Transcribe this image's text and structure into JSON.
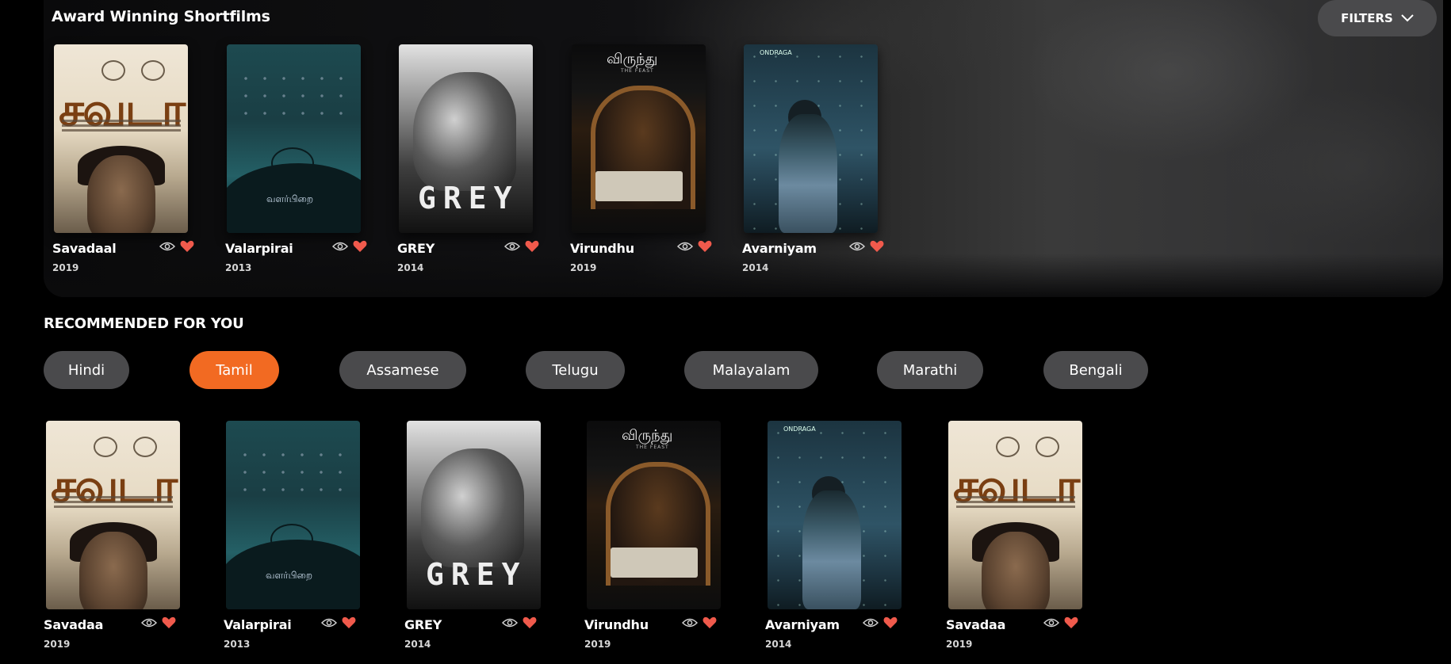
{
  "award": {
    "title": "Award Winning Shortfilms",
    "filters_label": "FILTERS",
    "films": [
      {
        "title": "Savadaal",
        "year": "2019",
        "poster": "savadaa"
      },
      {
        "title": "Valarpirai",
        "year": "2013",
        "poster": "valarpirai"
      },
      {
        "title": "GREY",
        "year": "2014",
        "poster": "grey"
      },
      {
        "title": "Virundhu",
        "year": "2019",
        "poster": "virundhu"
      },
      {
        "title": "Avarniyam",
        "year": "2014",
        "poster": "avarniyam"
      }
    ]
  },
  "recommended": {
    "title": "RECOMMENDED FOR YOU",
    "languages": [
      "Hindi",
      "Tamil",
      "Assamese",
      "Telugu",
      "Malayalam",
      "Marathi",
      "Bengali"
    ],
    "active_language": "Tamil",
    "films": [
      {
        "title": "Savadaa",
        "year": "2019",
        "poster": "savadaa"
      },
      {
        "title": "Valarpirai",
        "year": "2013",
        "poster": "valarpirai"
      },
      {
        "title": "GREY",
        "year": "2014",
        "poster": "grey"
      },
      {
        "title": "Virundhu",
        "year": "2019",
        "poster": "virundhu"
      },
      {
        "title": "Avarniyam",
        "year": "2014",
        "poster": "avarniyam"
      },
      {
        "title": "Savadaa",
        "year": "2019",
        "poster": "savadaa"
      }
    ]
  },
  "posters": {
    "savadaa": {
      "title_text": "சவடா"
    },
    "valarpirai": {
      "title_text": "வளர்பிறை"
    },
    "grey": {
      "title_text": "GREY"
    },
    "virundhu": {
      "title_text": "விருந்து",
      "subtitle": "THE FEAST"
    },
    "avarniyam": {
      "logo_text": "ONDRAGA"
    }
  },
  "colors": {
    "accent": "#f26a22",
    "heart": "#f05a4c",
    "pill_bg": "#4a4a4c"
  },
  "icons": {
    "views": "eye-icon",
    "favorite": "heart-icon",
    "filters": "chevron-down-icon"
  }
}
